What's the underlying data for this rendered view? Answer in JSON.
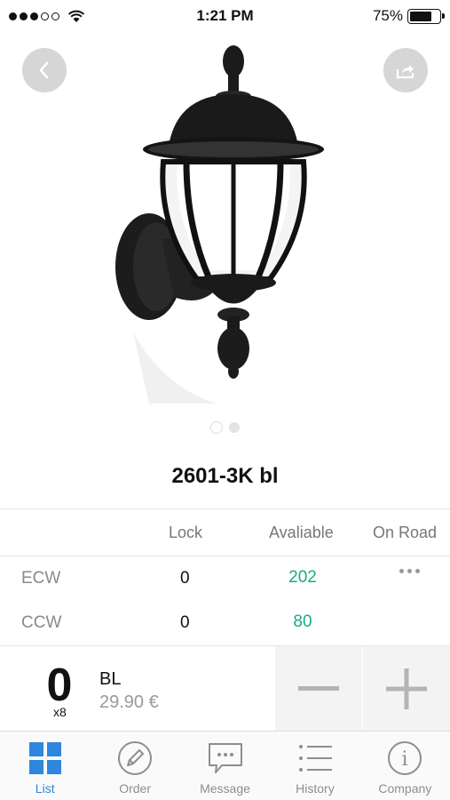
{
  "status_bar": {
    "time": "1:21 PM",
    "battery_percent": "75%",
    "battery_level": 0.75,
    "signal_bars_filled": 3,
    "signal_bars_total": 5
  },
  "product": {
    "title": "2601-3K bl",
    "image_page": 1,
    "image_count": 2
  },
  "stock": {
    "columns": {
      "lock": "Lock",
      "available": "Avaliable",
      "on_road": "On Road"
    },
    "rows": [
      {
        "label": "ECW",
        "lock": "0",
        "available": "202"
      },
      {
        "label": "CCW",
        "lock": "0",
        "available": "80"
      }
    ],
    "available_color": "#1aa889"
  },
  "order_line": {
    "quantity": "0",
    "multiplier": "x8",
    "code": "BL",
    "price": "29.90 €"
  },
  "tabs": [
    {
      "label": "List",
      "icon": "grid-icon"
    },
    {
      "label": "Order",
      "icon": "pen-icon"
    },
    {
      "label": "Message",
      "icon": "chat-icon"
    },
    {
      "label": "History",
      "icon": "list-icon"
    },
    {
      "label": "Company",
      "icon": "info-icon"
    }
  ],
  "colors": {
    "accent": "#2e86de",
    "available": "#1aa889"
  }
}
